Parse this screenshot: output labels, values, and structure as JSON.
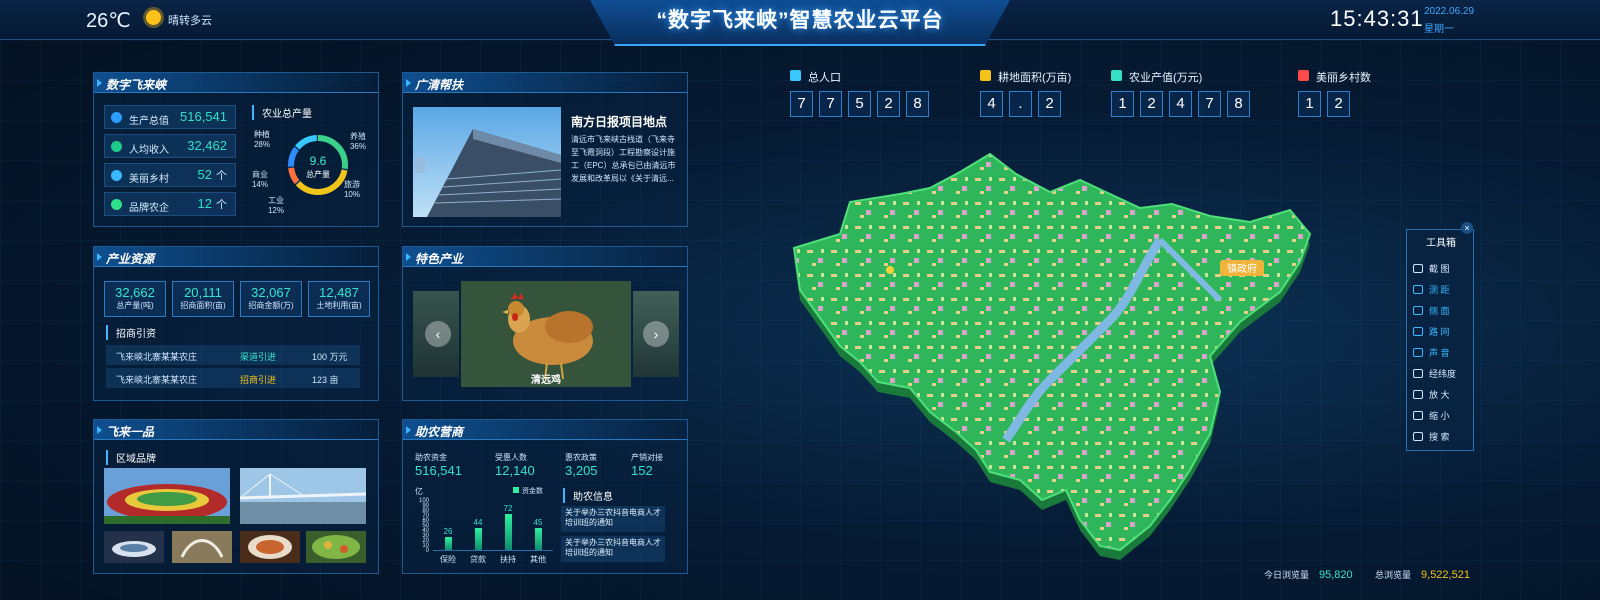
{
  "header": {
    "title": "“数字飞来峡”智慧农业云平台",
    "temperature": "26℃",
    "weather": "晴转多云",
    "time": "15:43:31",
    "date": "2022.06.29",
    "weekday": "星期一"
  },
  "p1": {
    "title": "数字飞来峡",
    "stats": [
      {
        "label": "生产总值",
        "value": "516,541",
        "unit": ""
      },
      {
        "label": "人均收入",
        "value": "32,462",
        "unit": ""
      },
      {
        "label": "美丽乡村",
        "value": "52",
        "unit": "个"
      },
      {
        "label": "品牌农企",
        "value": "12",
        "unit": "个"
      }
    ],
    "donut_title": "农业总产量",
    "donut_value": "9.6",
    "donut_label": "总产量",
    "segments": [
      {
        "name": "种植",
        "pct": "28%",
        "value": 28,
        "color": "#3bd18b"
      },
      {
        "name": "养殖",
        "pct": "36%",
        "value": 36,
        "color": "#f0c419"
      },
      {
        "name": "旅游",
        "pct": "10%",
        "value": 10,
        "color": "#ff6f3c"
      },
      {
        "name": "工业",
        "pct": "12%",
        "value": 12,
        "color": "#2f8cff"
      },
      {
        "name": "商业",
        "pct": "14%",
        "value": 14,
        "color": "#37c8ff"
      }
    ]
  },
  "p2": {
    "title": "广清帮扶",
    "news_title": "南方日报项目地点",
    "news_body": "清远市飞来峡古栈道（飞来寺至飞霞洞段）工程勘察设计施工（EPC）总承包已由清远市发展和改革局以《关于清远..."
  },
  "p3": {
    "title": "产业资源",
    "boxes": [
      {
        "value": "32,662",
        "label": "总产量(吨)"
      },
      {
        "value": "20,111",
        "label": "招商面积(亩)"
      },
      {
        "value": "32,067",
        "label": "招商金额(万)"
      },
      {
        "value": "12,487",
        "label": "土地利用(亩)"
      }
    ],
    "sub": "招商引资",
    "rows": [
      {
        "name": "飞来峡北寨某某农庄",
        "type": "渠道引进",
        "amount": "100 万元"
      },
      {
        "name": "飞来峡北寨某某农庄",
        "type": "招商引进",
        "amount": "123 亩"
      }
    ]
  },
  "p4": {
    "title": "特色产业",
    "caption": "清远鸡"
  },
  "p5": {
    "title": "飞来一品",
    "sub": "区域品牌"
  },
  "p6": {
    "title": "助农营商",
    "metrics": [
      {
        "label": "助农资金",
        "value": "516,541"
      },
      {
        "label": "受惠人数",
        "value": "12,140"
      },
      {
        "label": "惠农政策",
        "value": "3,205"
      },
      {
        "label": "产销对接",
        "value": "152"
      }
    ],
    "chart_data": {
      "type": "bar",
      "categories": [
        "保险",
        "贷款",
        "扶持",
        "其他"
      ],
      "values": [
        26,
        44,
        72,
        45
      ],
      "ylabel": "亿",
      "ylim": [
        0,
        100
      ],
      "yticks": [
        0,
        10,
        20,
        30,
        40,
        50,
        60,
        70,
        80,
        90,
        100
      ],
      "legend": "资金数"
    },
    "info_title": "助农信息",
    "news": [
      "关于举办三农抖音电商人才培训班的通知",
      "关于举办三农抖音电商人才培训班的通知"
    ]
  },
  "stats": [
    {
      "label": "总人口",
      "digits": [
        "7",
        "7",
        "5",
        "2",
        "8"
      ]
    },
    {
      "label": "耕地面积(万亩)",
      "digits": [
        "4",
        ".",
        "2"
      ]
    },
    {
      "label": "农业产值(万元)",
      "digits": [
        "1",
        "2",
        "4",
        "7",
        "8"
      ]
    },
    {
      "label": "美丽乡村数",
      "digits": [
        "1",
        "2"
      ]
    }
  ],
  "map": {
    "marker": "镇政府"
  },
  "toolbox": {
    "title": "工具箱",
    "items": [
      "截 图",
      "测 距",
      "侧 面",
      "路 网",
      "声 音",
      "经纬度",
      "放 大",
      "缩 小",
      "搜 索"
    ]
  },
  "footer": {
    "today_label": "今日浏览量",
    "today": "95,820",
    "total_label": "总浏览量",
    "total": "9,522,521"
  }
}
